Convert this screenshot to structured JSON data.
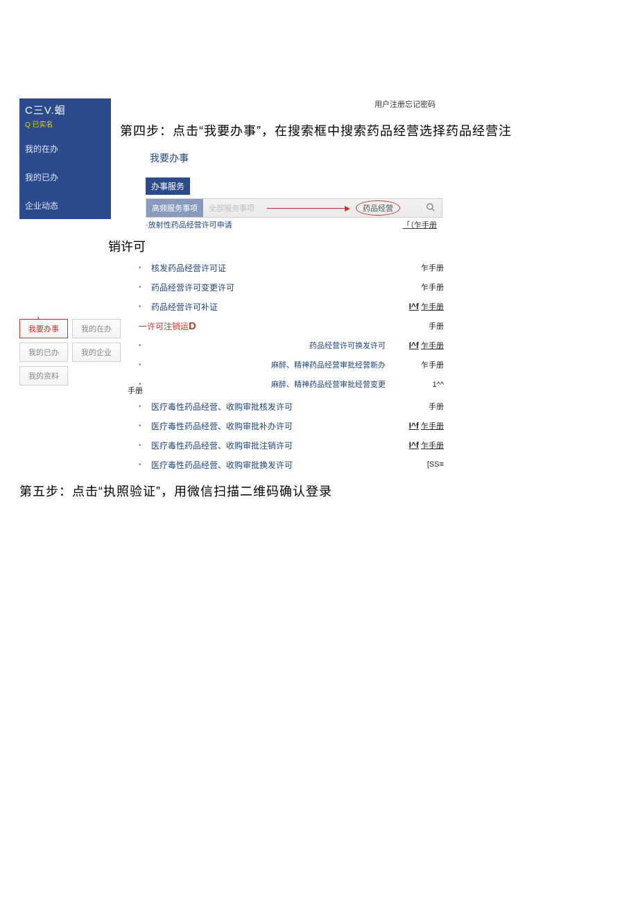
{
  "top": {
    "register": "用户注册忘记密码"
  },
  "sidebar": {
    "brand": "C三V.蛔",
    "realname": "Q 已实名",
    "nav": [
      "我的在办",
      "我的已办",
      "企业动态"
    ]
  },
  "step4": "第四步：点击“我要办事”，在搜索框中搜索药品经营选择药品经营注",
  "woyao": "我要办事",
  "banshi": "办事服务",
  "search": {
    "freq": "高频服务事项",
    "all": "全部服务事项",
    "term": "药品经营"
  },
  "radio_line": {
    "left": "·放射性药品经营许可申请",
    "right": "「（乍手册"
  },
  "xiaoxu": "销许可",
  "items1": [
    {
      "label": "核发药品经营许可证",
      "right": "乍手册"
    },
    {
      "label": "药品经营许可变更许可",
      "right": "乍手册"
    },
    {
      "label": "药品经营许可补证",
      "right_bold": "I^f",
      "right": "乍手册"
    }
  ],
  "cancel_line": {
    "label": "一许可注销运",
    "d": "D",
    "right": "手册"
  },
  "items2": [
    {
      "rlabel": "药品经营许可换发许可",
      "rbold": "I^f",
      "rtext": "乍手册"
    },
    {
      "rlabel": "麻醉、精神药品经营审批经营新办",
      "rtext": "乍手册"
    },
    {
      "rlabel": "麻醉、精神药品经营审批经营变更",
      "rbold": "1^^"
    }
  ],
  "shouce": "手册",
  "items3": [
    {
      "label": "医疗毒性药品经营、收购审批核发许可",
      "right": "手册"
    },
    {
      "label": "医疗毒性药品经营、收购审批补办许可",
      "right_bold": "I^f",
      "right": "乍手册"
    },
    {
      "label": "医疗毒性药品经营、收购审批注销许可",
      "right_bold": "I^f",
      "right": "乍手册"
    },
    {
      "label": "医疗毒性药品经营、收购审批换发许可",
      "right_bold": "[SS≡"
    }
  ],
  "tabs": {
    "woyao": "我要办事",
    "zaib": "我的在办",
    "yiban": "我的已办",
    "qiye": "我的企业",
    "ziliao": "我的资料"
  },
  "step5": "第五步：点击“执照验证”，用微信扫描二维码确认登录"
}
